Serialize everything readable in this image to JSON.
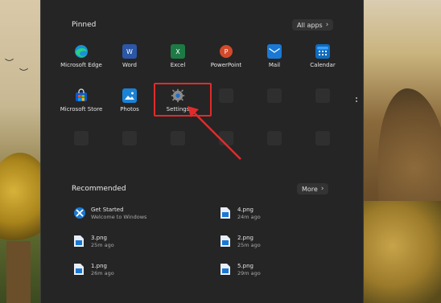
{
  "pinned": {
    "title": "Pinned",
    "all_apps_label": "All apps",
    "apps": [
      {
        "label": "Microsoft Edge",
        "icon": "edge-icon"
      },
      {
        "label": "Word",
        "icon": "word-icon"
      },
      {
        "label": "Excel",
        "icon": "excel-icon"
      },
      {
        "label": "PowerPoint",
        "icon": "powerpoint-icon"
      },
      {
        "label": "Mail",
        "icon": "mail-icon"
      },
      {
        "label": "Calendar",
        "icon": "calendar-icon"
      },
      {
        "label": "Microsoft Store",
        "icon": "store-icon"
      },
      {
        "label": "Photos",
        "icon": "photos-icon"
      },
      {
        "label": "Settings",
        "icon": "gear-icon"
      }
    ]
  },
  "recommended": {
    "title": "Recommended",
    "more_label": "More",
    "items": [
      {
        "title": "Get Started",
        "subtitle": "Welcome to Windows"
      },
      {
        "title": "4.png",
        "subtitle": "24m ago"
      },
      {
        "title": "3.png",
        "subtitle": "25m ago"
      },
      {
        "title": "2.png",
        "subtitle": "25m ago"
      },
      {
        "title": "1.png",
        "subtitle": "26m ago"
      },
      {
        "title": "5.png",
        "subtitle": "29m ago"
      }
    ]
  },
  "colors": {
    "highlight": "#e12b2b",
    "menu_background": "#252525"
  }
}
